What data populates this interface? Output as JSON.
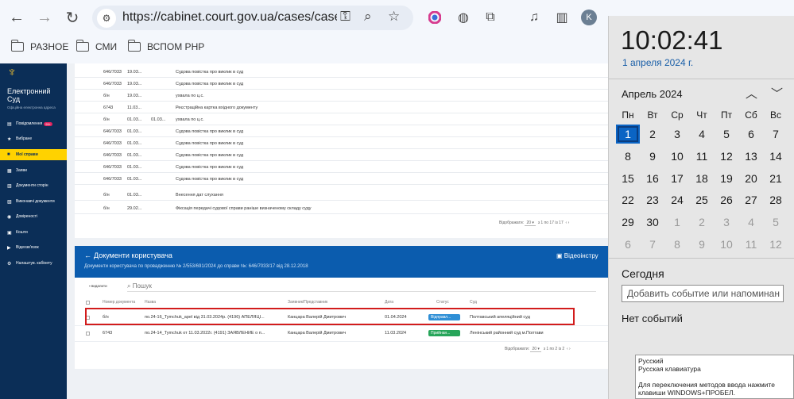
{
  "browser": {
    "url": "https://cabinet.court.gov.ua/cases/case=7...",
    "back_icon": "←",
    "forward_icon": "→",
    "reload_icon": "↻",
    "profile_initial": "K",
    "bookmarks": [
      "РАЗНОЕ",
      "СМИ",
      "ВСПОМ PHP"
    ]
  },
  "sidebar": {
    "logo": "♆",
    "brand_line1": "Електронний",
    "brand_line2": "Суд",
    "brand_sub": "Офіційна електронна адреса",
    "items": [
      {
        "label": "Повідомлення",
        "icon": "▤",
        "badge": "99+"
      },
      {
        "label": "Вибране",
        "icon": "★"
      },
      {
        "label": "Мої справи",
        "icon": "■"
      },
      {
        "label": "Заяви",
        "icon": "▦"
      },
      {
        "label": "Документи сторін",
        "icon": "▥"
      },
      {
        "label": "Виконавчі документи",
        "icon": "▧"
      },
      {
        "label": "Довіреності",
        "icon": "◉"
      },
      {
        "label": "Кошти",
        "icon": "▣"
      },
      {
        "label": "Відеозв'язок",
        "icon": "▶"
      },
      {
        "label": "Налаштув. кабінету",
        "icon": "⚙"
      }
    ]
  },
  "documents_list": {
    "rows": [
      {
        "num": "646/7033",
        "date": "19.03...",
        "date2": "",
        "name": "Судова повістка про виклик в суд"
      },
      {
        "num": "646/7033",
        "date": "19.03...",
        "date2": "",
        "name": "Судова повістка про виклик в суд"
      },
      {
        "num": "б/н",
        "date": "19.03...",
        "date2": "",
        "name": "ухвала по ц.с."
      },
      {
        "num": "6743",
        "date": "11.03...",
        "date2": "",
        "name": "Реєстраційна картка вхідного документу"
      },
      {
        "num": "б/н",
        "date": "01.03...",
        "date2": "01.03...",
        "name": "ухвала по ц.с."
      },
      {
        "num": "646/7033",
        "date": "01.03...",
        "date2": "",
        "name": "Судова повістка про виклик в суд"
      },
      {
        "num": "646/7033",
        "date": "01.03...",
        "date2": "",
        "name": "Судова повістка про виклик в суд"
      },
      {
        "num": "646/7033",
        "date": "01.03...",
        "date2": "",
        "name": "Судова повістка про виклик в суд"
      },
      {
        "num": "646/7033",
        "date": "01.03...",
        "date2": "",
        "name": "Судова повістка про виклик в суд"
      },
      {
        "num": "646/7033",
        "date": "01.03...",
        "date2": "",
        "name": "Судова повістка про виклик в суд"
      },
      {
        "num": "б/н",
        "date": "01.03...",
        "date2": "",
        "name": "Внесення дат слухання"
      },
      {
        "num": "б/н",
        "date": "29.02...",
        "date2": "",
        "name": "Фіксація передачі судової справи раніше визначеному складу суду"
      }
    ],
    "pager_label": "Відображати:",
    "pager_size": "20",
    "pager_range": "з 1 по 17 із 17"
  },
  "user_docs": {
    "back_icon": "←",
    "title": "Документи користувача",
    "subtitle": "Документи користувача по провадженню № 2/553/691/2024 до справи №: 646/7033/17 від 28.12.2018",
    "video_label": "Відеоінстру",
    "delete_label": "видалити",
    "search_placeholder": "Пошук",
    "columns": [
      "Номер документа",
      "Назва",
      "Заявник/Представник",
      "Дата",
      "Статус",
      "Суд"
    ],
    "rows": [
      {
        "num": "б/н",
        "name": "по.24-16_Tymchuk_apel від 31.03.2024р. (4196) АПЕЛЯЦІ...",
        "applicant": "Канцара Валерій Дмитрович",
        "date": "01.04.2024",
        "status": "Відправл...",
        "status_color": "#2f8fd6",
        "court": "Полтавський апеляційний суд"
      },
      {
        "num": "6743",
        "name": "по.24-14_Tymchuk от 11.03.2022г. (4191) ЗАЯВЛЕНИЕ о п...",
        "applicant": "Канцара Валерій Дмитрович",
        "date": "11.03.2024",
        "status": "Прийнан...",
        "status_color": "#27a55a",
        "court": "Ленінський районний суд м.Полтави"
      }
    ],
    "pager_label": "Відображати:",
    "pager_size": "20",
    "pager_range": "з 1 по 2 із 2"
  },
  "clock": {
    "time": "10:02:41",
    "date": "1 апреля 2024 г.",
    "month": "Апрель 2024",
    "weekdays": [
      "Пн",
      "Вт",
      "Ср",
      "Чт",
      "Пт",
      "Сб",
      "Вс"
    ],
    "days": [
      [
        "1",
        "2",
        "3",
        "4",
        "5",
        "6",
        "7"
      ],
      [
        "8",
        "9",
        "10",
        "11",
        "12",
        "13",
        "14"
      ],
      [
        "15",
        "16",
        "17",
        "18",
        "19",
        "20",
        "21"
      ],
      [
        "22",
        "23",
        "24",
        "25",
        "26",
        "27",
        "28"
      ],
      [
        "29",
        "30",
        "1",
        "2",
        "3",
        "4",
        "5"
      ],
      [
        "6",
        "7",
        "8",
        "9",
        "10",
        "11",
        "12"
      ]
    ],
    "today_label": "Сегодня",
    "event_placeholder": "Добавить событие или напоминан",
    "no_events": "Нет событий"
  },
  "ime_popup": {
    "line1": "Русский",
    "line2": "Русская клавиатура",
    "line3": "Для переключения методов ввода нажмите клавиши WINDOWS+ПРОБЕЛ."
  }
}
